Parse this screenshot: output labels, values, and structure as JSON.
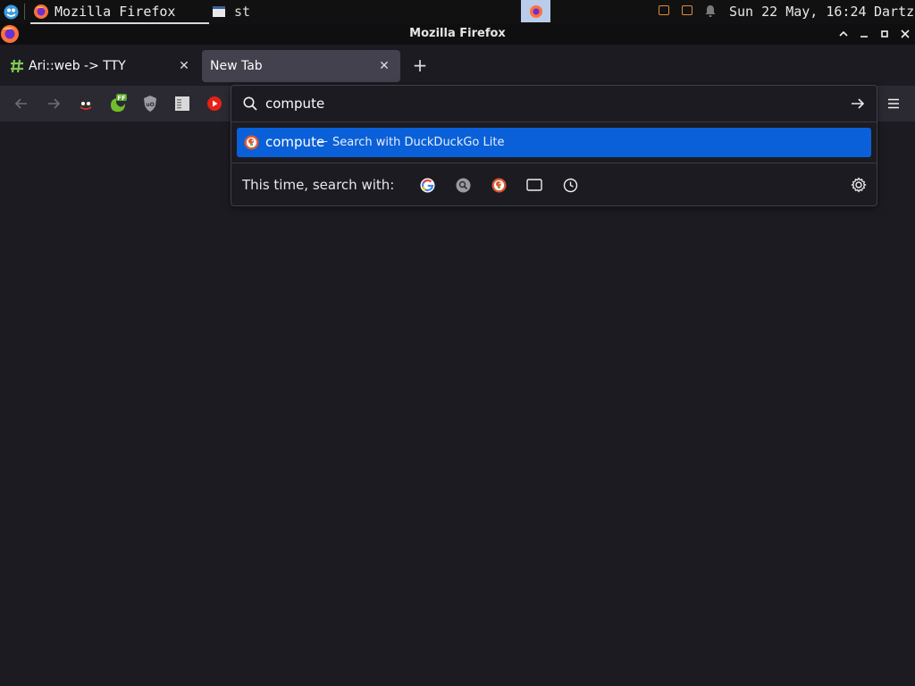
{
  "system_bar": {
    "taskbar": [
      {
        "label": "Mozilla Firefox",
        "icon": "firefox-icon",
        "active": true
      },
      {
        "label": "st",
        "icon": "terminal-window-icon",
        "active": false
      }
    ],
    "clock": "Sun 22 May, 16:24",
    "user": "Dartz",
    "tray_icons": [
      "chat-icon",
      "message-icon",
      "bell-icon"
    ]
  },
  "window": {
    "title": "Mozilla Firefox",
    "controls": [
      "maximize-up-icon",
      "minimize-icon",
      "restore-icon",
      "close-icon"
    ]
  },
  "tabs": [
    {
      "label": "Ari::web -> TTY",
      "icon": "hash-icon",
      "selected": false
    },
    {
      "label": "New Tab",
      "selected": true
    }
  ],
  "newtab_symbol": "+",
  "toolbar": {
    "extensions": [
      "privacy-badger-icon",
      "foxyproxy-icon",
      "ublock-origin-icon",
      "reader-icon",
      "youtube-icon"
    ],
    "menu_icon": "hamburger-menu-icon"
  },
  "urlbar": {
    "value": "compute",
    "result": {
      "query": "compute",
      "separator": "—",
      "action": "Search with DuckDuckGo Lite",
      "engine_icon": "duckduckgo-icon"
    },
    "oneoff_label": "This time, search with:",
    "oneoff_engines": [
      "google-icon",
      "search-engine-icon",
      "duckduckgo-icon",
      "tabs-icon",
      "history-icon"
    ],
    "settings_icon": "gear-icon"
  },
  "colors": {
    "accent": "#0a60d8",
    "background": "#1c1b22",
    "toolbar": "#2b2a33"
  }
}
